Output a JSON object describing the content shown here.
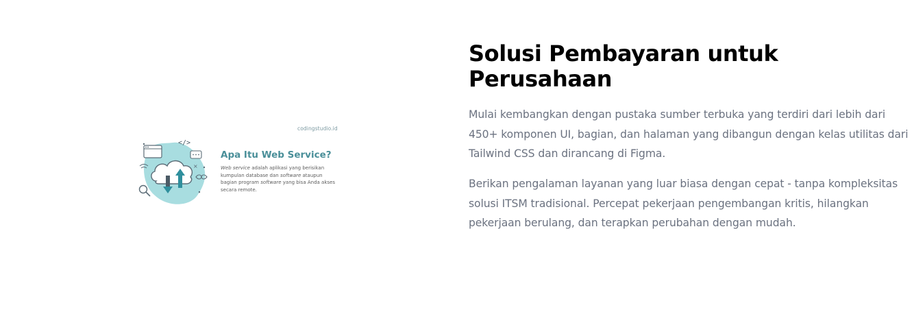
{
  "illustration": {
    "site": "codingstudio.id",
    "title": "Apa Itu Web Service?",
    "body_lead": "Web service",
    "body_part1": " adalah aplikasi yang berisikan kumpulan database dan ",
    "body_em": "software",
    "body_part2": " ataupun bagian program ",
    "body_em2": "software",
    "body_part3": " yang bisa Anda akses secara remote.",
    "colors": {
      "accent": "#4a8f99",
      "blob": "#a8dde0",
      "arrow": "#2f8f9d"
    }
  },
  "content": {
    "heading": "Solusi Pembayaran untuk Perusahaan",
    "paragraph1": "Mulai kembangkan dengan pustaka sumber terbuka yang terdiri dari lebih dari 450+ komponen UI, bagian, dan halaman yang dibangun dengan kelas utilitas dari Tailwind CSS dan dirancang di Figma.",
    "paragraph2": "Berikan pengalaman layanan yang luar biasa dengan cepat - tanpa kompleksitas solusi ITSM tradisional. Percepat pekerjaan pengembangan kritis, hilangkan pekerjaan berulang, dan terapkan perubahan dengan mudah."
  }
}
